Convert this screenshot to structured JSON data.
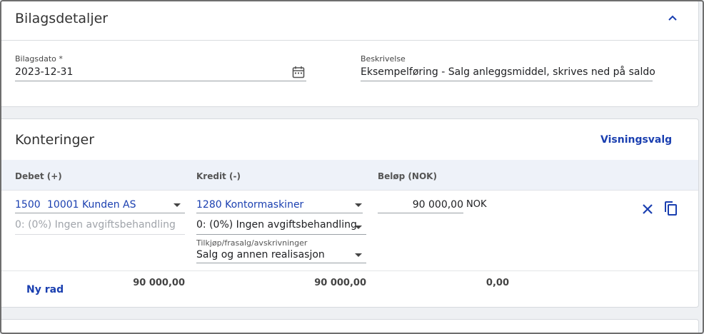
{
  "bilagsdetaljer": {
    "title": "Bilagsdetaljer",
    "date_label": "Bilagsdato *",
    "date_value": "2023-12-31",
    "desc_label": "Beskrivelse",
    "desc_value": "Eksempelføring - Salg anleggsmiddel, skrives ned på saldo"
  },
  "konteringer": {
    "title": "Konteringer",
    "view_options": "Visningsvalg",
    "columns": {
      "debet": "Debet (+)",
      "kredit": "Kredit (-)",
      "belop": "Beløp (NOK)"
    },
    "row": {
      "debet_account_no": "1500",
      "debet_account_name": "10001 Kunden AS",
      "debet_vat": "0: (0%) Ingen avgiftsbehandling",
      "kredit_account": "1280 Kontormaskiner",
      "kredit_vat": "0: (0%) Ingen avgiftsbehandling",
      "asset_label": "Tilkjøp/frasalg/avskrivninger",
      "asset_value": "Salg og annen realisasjon",
      "amount": "90 000,00",
      "currency": "NOK"
    },
    "footer": {
      "new_row": "Ny rad",
      "debet_sum": "90 000,00",
      "kredit_sum": "90 000,00",
      "balance": "0,00"
    }
  },
  "colors": {
    "accent": "#1a3fb0",
    "header_bg": "#eef2f9"
  },
  "icons": [
    "chevron-up-icon",
    "calendar-icon",
    "close-icon",
    "copy-icon",
    "dropdown-caret-icon"
  ]
}
